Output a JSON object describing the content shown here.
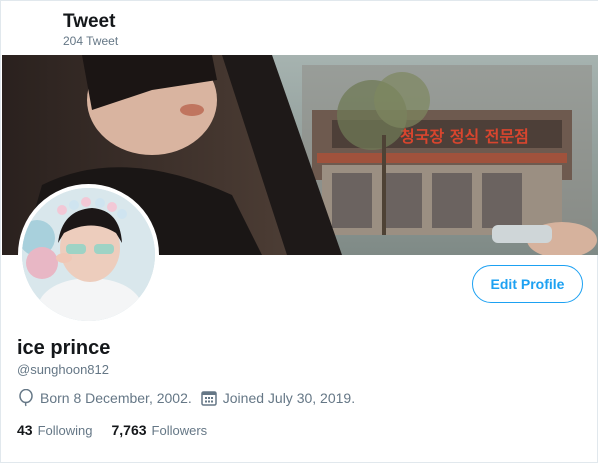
{
  "header": {
    "title": "Tweet",
    "tweet_count": "204 Tweet"
  },
  "profile": {
    "name": "ice prince",
    "handle": "@sunghoon812",
    "edit_button_label": "Edit Profile",
    "birthday_text": "Born 8 December, 2002.",
    "joined_text": "Joined July 30, 2019.",
    "following_count": "43",
    "following_label": "Following",
    "followers_count": "7,763",
    "followers_label": "Followers"
  },
  "banner": {
    "sign_text": "청국장 정식 전문점"
  },
  "icons": {
    "birthday": "balloon-icon",
    "joined": "calendar-icon"
  },
  "colors": {
    "accent": "#1da1f2",
    "muted_text": "#657786",
    "primary_text": "#14171a"
  }
}
